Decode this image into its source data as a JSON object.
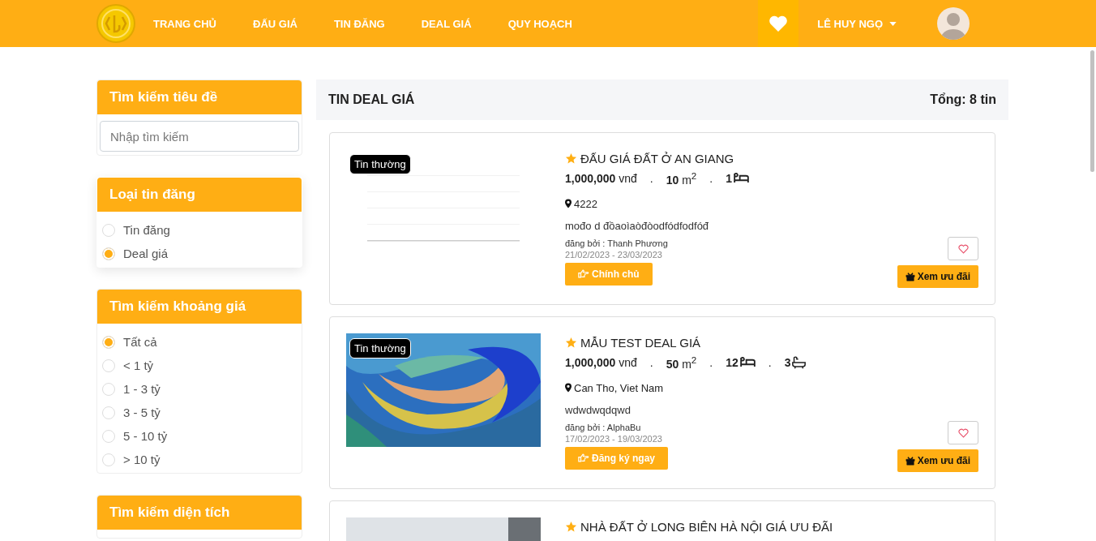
{
  "nav": {
    "items": [
      {
        "label": "TRANG CHỦ"
      },
      {
        "label": "ĐẤU GIÁ"
      },
      {
        "label": "TIN ĐĂNG"
      },
      {
        "label": "DEAL GIÁ"
      },
      {
        "label": "QUY HOẠCH"
      }
    ],
    "user": "LÊ HUY NGỌ"
  },
  "sidebar": [
    {
      "kind": "search",
      "title": "Tìm kiếm tiêu đề",
      "placeholder": "Nhập tìm kiếm"
    },
    {
      "kind": "radio",
      "title": "Loại tin đăng",
      "options": [
        {
          "label": "Tin đăng",
          "selected": false
        },
        {
          "label": "Deal giá",
          "selected": true
        }
      ]
    },
    {
      "kind": "radio",
      "title": "Tìm kiếm khoảng giá",
      "options": [
        {
          "label": "Tất cả",
          "selected": true
        },
        {
          "label": "< 1 tỷ",
          "selected": false
        },
        {
          "label": "1 - 3 tỷ",
          "selected": false
        },
        {
          "label": "3 - 5 tỷ",
          "selected": false
        },
        {
          "label": "5 - 10 tỷ",
          "selected": false
        },
        {
          "label": "> 10 tỷ",
          "selected": false
        }
      ]
    },
    {
      "kind": "radio",
      "title": "Tìm kiếm diện tích"
    }
  ],
  "main": {
    "title": "TIN DEAL GIÁ",
    "total": "Tổng: 8 tin"
  },
  "listings": [
    {
      "badge": "Tin thường",
      "title": "ĐẤU GIÁ ĐẤT Ở AN GIANG",
      "facts": [
        {
          "kind": "price",
          "value": "1,000,000",
          "unit": "vnđ"
        },
        {
          "kind": "dot",
          "text": "."
        },
        {
          "kind": "area",
          "value": "10",
          "unit": "m$^{2}$"
        },
        {
          "kind": "dot",
          "text": "."
        },
        {
          "kind": "bed",
          "value": "1"
        }
      ],
      "location": "4222",
      "description": "mođo d đồaoìaòđòodfódfodfóđ",
      "author": "đăng bởi : Thanh Phương",
      "dates": "21/02/2023 - 23/03/2023",
      "action": "Chính chủ",
      "offer": "Xem ưu đãi"
    },
    {
      "badge": "Tin thường",
      "title": "MẪU TEST DEAL GIÁ",
      "facts": [
        {
          "kind": "price",
          "value": "1,000,000",
          "unit": "vnđ"
        },
        {
          "kind": "dot",
          "text": "."
        },
        {
          "kind": "area",
          "value": "50",
          "unit": "m$^{2}$"
        },
        {
          "kind": "dot",
          "text": "."
        },
        {
          "kind": "bed",
          "value": "12"
        },
        {
          "kind": "dot",
          "text": "."
        },
        {
          "kind": "bath",
          "value": "3"
        }
      ],
      "location": "Can Tho, Viet Nam",
      "description": "wdwdwqdqwd",
      "author": "đăng bởi : AlphaBu",
      "dates": "17/02/2023 - 19/03/2023",
      "action": "Đăng ký ngay",
      "offer": "Xem ưu đãi"
    },
    {
      "title": "NHÀ ĐẤT Ở LONG BIÊN HÀ NỘI GIÁ ƯU ĐÃI"
    }
  ]
}
